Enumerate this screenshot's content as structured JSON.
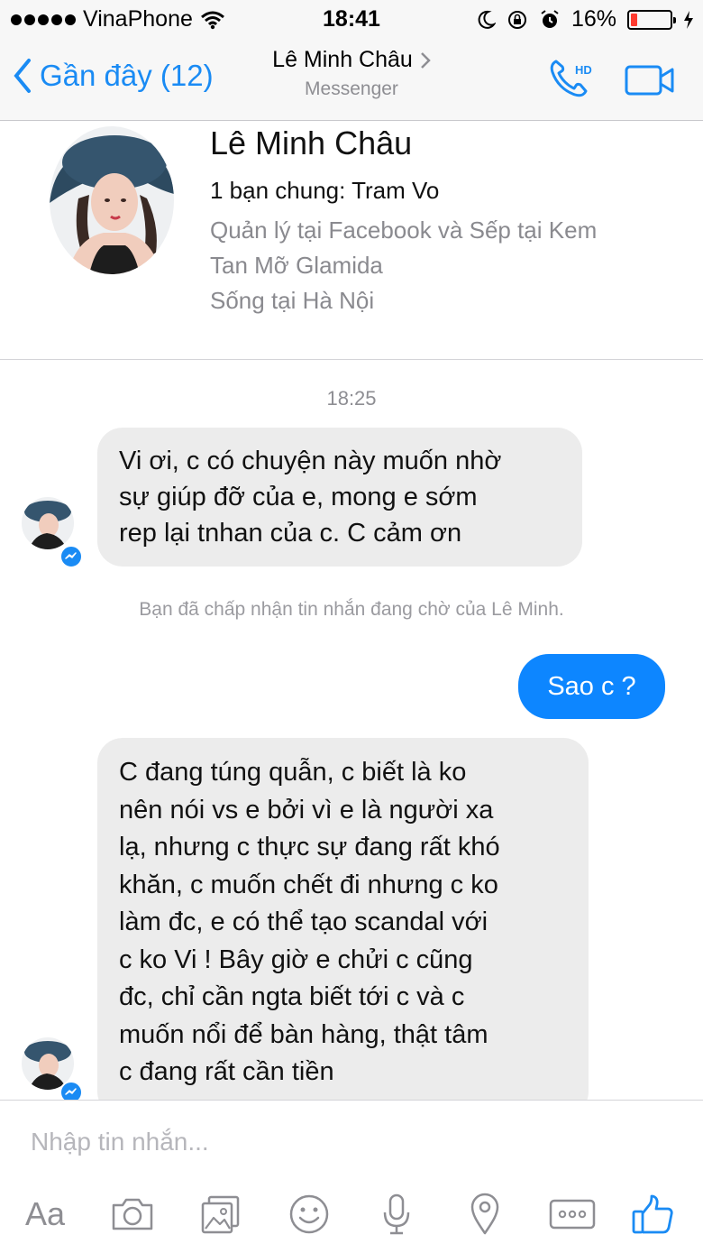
{
  "status_bar": {
    "carrier": "VinaPhone",
    "time": "18:41",
    "battery_percent": "16%",
    "battery_level": 0.16,
    "battery_color": "#ff3b30"
  },
  "nav": {
    "back_label": "Gần đây (12)",
    "title": "Lê Minh Châu",
    "subtitle": "Messenger",
    "call_icon": "phone-hd-icon",
    "video_icon": "video-camera-icon",
    "hd_text": "HD",
    "accent_color": "#1a8bf4"
  },
  "profile": {
    "name": "Lê Minh Châu",
    "mutual_friends": "1 bạn chung: Tram Vo",
    "work_line1": "Quản lý tại Facebook và Sếp tại Kem",
    "work_line2": "Tan Mỡ Glamida",
    "lives_in": "Sống tại Hà Nội"
  },
  "conversation": {
    "timestamp": "18:25",
    "messages": [
      {
        "direction": "incoming",
        "lines": [
          "Vi ơi, c có chuyện này muốn nhờ",
          "sự giúp đỡ của e, mong e sớm",
          "rep lại tnhan của c. C cảm ơn"
        ]
      },
      {
        "direction": "outgoing",
        "text": "Sao c ?"
      },
      {
        "direction": "incoming",
        "lines": [
          "C đang túng quẫn, c biết là ko",
          "nên nói vs e bởi vì e là người xa",
          "lạ, nhưng c thực sự đang rất khó",
          "khăn, c muốn chết đi nhưng c ko",
          "làm đc, e có thể tạo scandal với",
          "c ko Vi ! Bây giờ e chửi c cũng",
          "đc, chỉ cần ngta biết tới c và c",
          "muốn nổi để bàn hàng, thật tâm",
          "c đang rất cần tiền"
        ]
      }
    ],
    "system_note": "Bạn đã chấp nhận tin nhắn đang chờ của Lê Minh.",
    "outgoing_color": "#0d86ff",
    "incoming_color": "#ececec"
  },
  "composer": {
    "placeholder": "Nhập tin nhắn...",
    "value": "",
    "tools": [
      {
        "icon": "text-format-icon",
        "label": "Aa"
      },
      {
        "icon": "camera-icon"
      },
      {
        "icon": "photo-gallery-icon"
      },
      {
        "icon": "emoji-icon"
      },
      {
        "icon": "microphone-icon"
      },
      {
        "icon": "location-icon"
      },
      {
        "icon": "more-icon"
      },
      {
        "icon": "thumbs-up-icon"
      }
    ]
  }
}
